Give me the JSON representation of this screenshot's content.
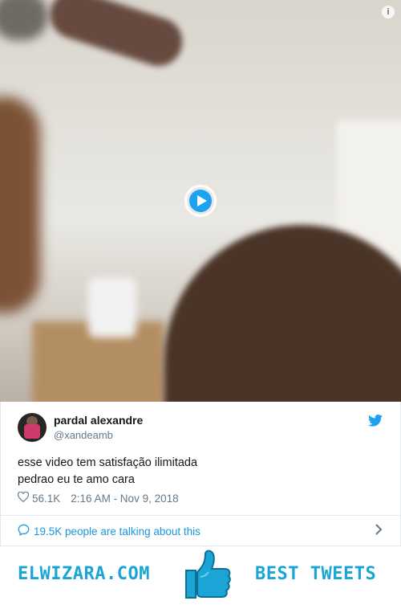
{
  "tweet": {
    "author_name": "pardal alexandre",
    "author_handle": "@xandeamb",
    "text_line1": "esse video tem satisfação ilimitada",
    "text_line2": "pedrao eu te amo cara",
    "likes": "56.1K",
    "timestamp": "2:16 AM - Nov 9, 2018",
    "talking": "19.5K people are talking about this"
  },
  "banner": {
    "site": "ELWIZARA.COM",
    "tagline": "BEST TWEETS"
  },
  "colors": {
    "twitter_blue": "#1da1f2",
    "banner_blue": "#1ba5d6",
    "text": "#14171a",
    "muted": "#657786"
  },
  "icons": [
    "info-icon",
    "play-icon",
    "twitter-bird-icon",
    "heart-icon",
    "chat-bubble-icon",
    "chevron-right-icon",
    "thumbs-up-icon"
  ]
}
